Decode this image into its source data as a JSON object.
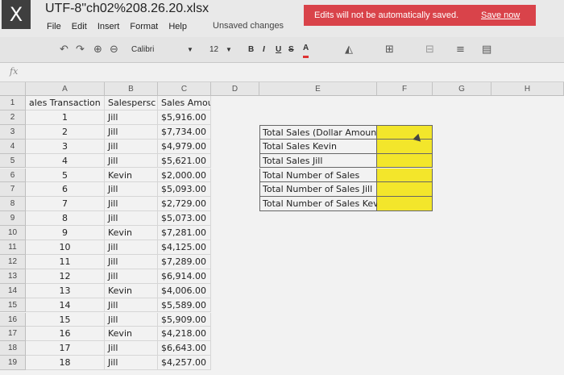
{
  "app": {
    "logo": "X",
    "title": "UTF-8\"ch02%208.26.20.xlsx",
    "menu": [
      "File",
      "Edit",
      "Insert",
      "Format",
      "Help"
    ],
    "status": "Unsaved changes",
    "banner_text": "Edits will not be automatically saved.",
    "banner_link": "Save now",
    "banner_color": "#d9434a"
  },
  "toolbar": {
    "font_name": "Calibri",
    "font_size": "12",
    "bold": "B",
    "italic": "I",
    "underline": "U",
    "strike": "S",
    "font_color_label": "A",
    "icons": [
      "undo-icon",
      "redo-icon",
      "zoom-in-icon",
      "zoom-out-icon",
      "fill-color-icon",
      "borders-icon",
      "merge-icon",
      "wrap-icon",
      "align-icon"
    ]
  },
  "formula_bar": {
    "fx_label": "fx",
    "value": ""
  },
  "sheet": {
    "columns": [
      "A",
      "B",
      "C",
      "D",
      "E",
      "F",
      "G",
      "H"
    ],
    "rows": [
      "1",
      "2",
      "3",
      "4",
      "5",
      "6",
      "7",
      "8",
      "9",
      "10",
      "11",
      "12",
      "13",
      "14",
      "15",
      "16",
      "17",
      "18",
      "19"
    ],
    "header": {
      "a": "ales Transaction",
      "b": "Salespersc",
      "c": "Sales Amou"
    },
    "data": [
      {
        "a": "1",
        "b": "Jill",
        "c": "$5,916.00"
      },
      {
        "a": "2",
        "b": "Jill",
        "c": "$7,734.00"
      },
      {
        "a": "3",
        "b": "Jill",
        "c": "$4,979.00"
      },
      {
        "a": "4",
        "b": "Jill",
        "c": "$5,621.00"
      },
      {
        "a": "5",
        "b": "Kevin",
        "c": "$2,000.00"
      },
      {
        "a": "6",
        "b": "Jill",
        "c": "$5,093.00"
      },
      {
        "a": "7",
        "b": "Jill",
        "c": "$2,729.00"
      },
      {
        "a": "8",
        "b": "Jill",
        "c": "$5,073.00"
      },
      {
        "a": "9",
        "b": "Kevin",
        "c": "$7,281.00"
      },
      {
        "a": "10",
        "b": "Jill",
        "c": "$4,125.00"
      },
      {
        "a": "11",
        "b": "Jill",
        "c": "$7,289.00"
      },
      {
        "a": "12",
        "b": "Jill",
        "c": "$6,914.00"
      },
      {
        "a": "13",
        "b": "Kevin",
        "c": "$4,006.00"
      },
      {
        "a": "14",
        "b": "Jill",
        "c": "$5,589.00"
      },
      {
        "a": "15",
        "b": "Jill",
        "c": "$5,909.00"
      },
      {
        "a": "16",
        "b": "Kevin",
        "c": "$4,218.00"
      },
      {
        "a": "17",
        "b": "Jill",
        "c": "$6,643.00"
      },
      {
        "a": "18",
        "b": "Jill",
        "c": "$4,257.00"
      }
    ],
    "summary": [
      "Total Sales (Dollar Amount)",
      "Total Sales Kevin",
      "Total Sales Jill",
      "Total Number of Sales",
      "Total Number of Sales Jill",
      "Total Number of Sales Kevin"
    ],
    "highlight_color": "#f3e62b"
  }
}
